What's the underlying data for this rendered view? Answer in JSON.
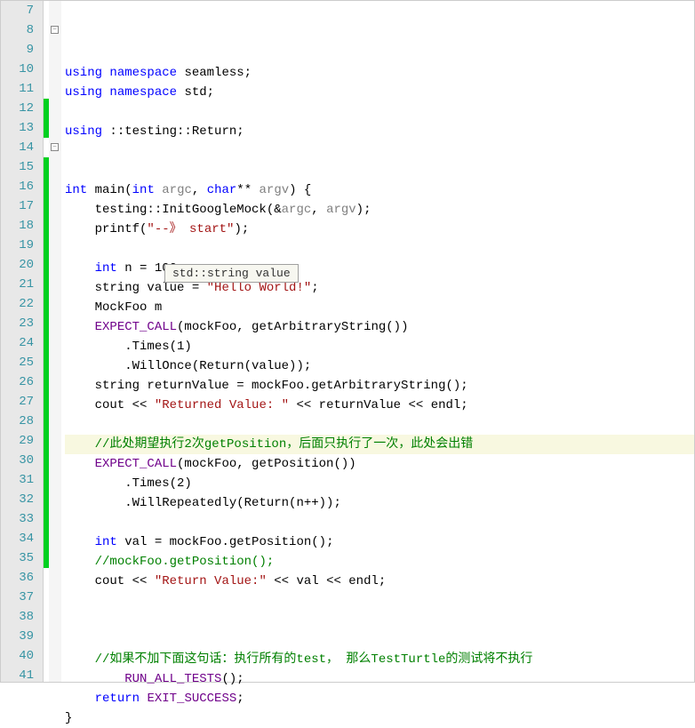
{
  "tooltip": "std::string value",
  "lines": [
    {
      "n": 7,
      "bar": false,
      "fold": null,
      "html": ""
    },
    {
      "n": 8,
      "bar": false,
      "fold": "minus",
      "html": "<span class='kw'>using</span> <span class='kw'>namespace</span> seamless;"
    },
    {
      "n": 9,
      "bar": false,
      "fold": null,
      "html": "<span class='kw'>using</span> <span class='kw'>namespace</span> std;"
    },
    {
      "n": 10,
      "bar": false,
      "fold": null,
      "html": ""
    },
    {
      "n": 11,
      "bar": false,
      "fold": null,
      "html": "<span class='kw'>using</span> ::testing::Return;"
    },
    {
      "n": 12,
      "bar": true,
      "fold": null,
      "html": ""
    },
    {
      "n": 13,
      "bar": true,
      "fold": null,
      "html": ""
    },
    {
      "n": 14,
      "bar": false,
      "fold": "minus",
      "html": "<span class='kw'>int</span> main(<span class='kw'>int</span> <span class='ident'>argc</span>, <span class='kw'>char</span>** <span class='ident'>argv</span>) {"
    },
    {
      "n": 15,
      "bar": true,
      "fold": null,
      "html": "    testing::InitGoogleMock(&amp;<span class='ident'>argc</span>, <span class='ident'>argv</span>);"
    },
    {
      "n": 16,
      "bar": true,
      "fold": null,
      "html": "    printf(<span class='str'>\"--》 start\"</span>);"
    },
    {
      "n": 17,
      "bar": true,
      "fold": null,
      "html": ""
    },
    {
      "n": 18,
      "bar": true,
      "fold": null,
      "html": "    <span class='kw'>int</span> n = 100;"
    },
    {
      "n": 19,
      "bar": true,
      "fold": null,
      "html": "    string value = <span class='str'>\"Hello World!\"</span>;"
    },
    {
      "n": 20,
      "bar": true,
      "fold": null,
      "html": "    MockFoo m"
    },
    {
      "n": 21,
      "bar": true,
      "fold": null,
      "html": "    <span class='macro'>EXPECT_CALL</span>(mockFoo, getArbitraryString())"
    },
    {
      "n": 22,
      "bar": true,
      "fold": null,
      "html": "        .Times(1)"
    },
    {
      "n": 23,
      "bar": true,
      "fold": null,
      "html": "        .WillOnce(Return(value));"
    },
    {
      "n": 24,
      "bar": true,
      "fold": null,
      "html": "    string returnValue = mockFoo.getArbitraryString();"
    },
    {
      "n": 25,
      "bar": true,
      "fold": null,
      "html": "    cout &lt;&lt; <span class='str'>\"Returned Value: \"</span> &lt;&lt; returnValue &lt;&lt; endl;"
    },
    {
      "n": 26,
      "bar": true,
      "fold": null,
      "html": ""
    },
    {
      "n": 27,
      "bar": true,
      "fold": null,
      "hl": true,
      "html": "    <span class='comment'>//此处期望执行2次getPosition，后面只执行了一次，此处会出错</span>"
    },
    {
      "n": 28,
      "bar": true,
      "fold": null,
      "html": "    <span class='macro'>EXPECT_CALL</span>(mockFoo, getPosition())"
    },
    {
      "n": 29,
      "bar": true,
      "fold": null,
      "html": "        .Times(2)"
    },
    {
      "n": 30,
      "bar": true,
      "fold": null,
      "html": "        .WillRepeatedly(Return(n++));"
    },
    {
      "n": 31,
      "bar": true,
      "fold": null,
      "html": ""
    },
    {
      "n": 32,
      "bar": true,
      "fold": null,
      "html": "    <span class='kw'>int</span> val = mockFoo.getPosition();"
    },
    {
      "n": 33,
      "bar": true,
      "fold": null,
      "html": "    <span class='comment'>//mockFoo.getPosition();</span>"
    },
    {
      "n": 34,
      "bar": true,
      "fold": null,
      "html": "    cout &lt;&lt; <span class='str'>\"Return Value:\"</span> &lt;&lt; val &lt;&lt; endl;"
    },
    {
      "n": 35,
      "bar": true,
      "fold": null,
      "html": ""
    },
    {
      "n": 36,
      "bar": false,
      "fold": null,
      "html": ""
    },
    {
      "n": 37,
      "bar": false,
      "fold": null,
      "html": ""
    },
    {
      "n": 38,
      "bar": false,
      "fold": null,
      "html": "    <span class='comment'>//如果不加下面这句话：执行所有的test， 那么TestTurtle的测试将不执行</span>"
    },
    {
      "n": 39,
      "bar": false,
      "fold": null,
      "html": "        <span class='macro'>RUN_ALL_TESTS</span>();"
    },
    {
      "n": 40,
      "bar": false,
      "fold": null,
      "html": "    <span class='kw'>return</span> <span class='macro'>EXIT_SUCCESS</span>;"
    },
    {
      "n": 41,
      "bar": false,
      "fold": null,
      "html": "}"
    }
  ]
}
